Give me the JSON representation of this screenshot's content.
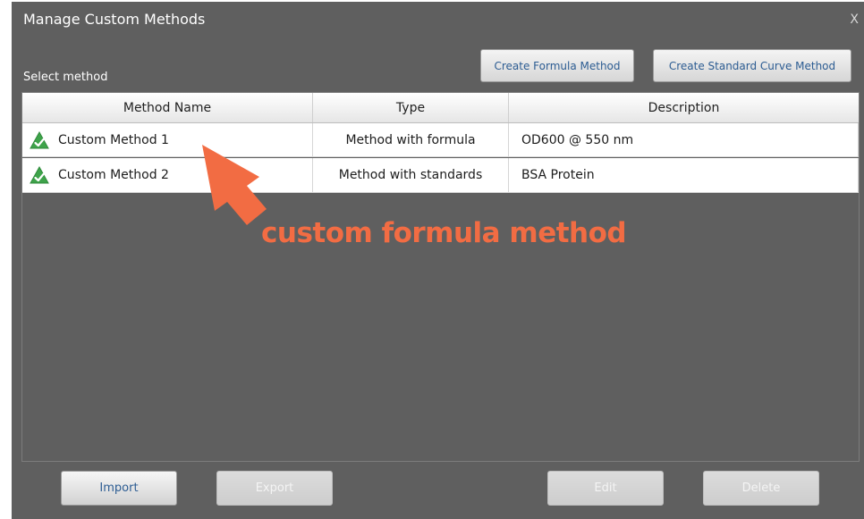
{
  "dialog": {
    "title": "Manage Custom Methods",
    "close_label": "X",
    "select_label": "Select method",
    "bg_color": "#5f5f5f"
  },
  "top_buttons": {
    "create_formula": "Create Formula Method",
    "create_curve": "Create Standard Curve Method"
  },
  "table": {
    "headers": [
      "Method Name",
      "Type",
      "Description"
    ],
    "rows": [
      {
        "icon": "green-check-triangle-icon",
        "name": "Custom Method 1",
        "type": "Method with formula",
        "description": "OD600 @ 550 nm"
      },
      {
        "icon": "green-check-triangle-icon",
        "name": "Custom Method 2",
        "type": "Method with standards",
        "description": "BSA Protein"
      }
    ]
  },
  "bottom_buttons": {
    "import": "Import",
    "export": "Export",
    "edit": "Edit",
    "delete": "Delete"
  },
  "annotation": {
    "text": "custom formula method",
    "color": "#f26c43"
  },
  "colors": {
    "accent_text": "#2d5d93",
    "status_green": "#3ea34a"
  }
}
